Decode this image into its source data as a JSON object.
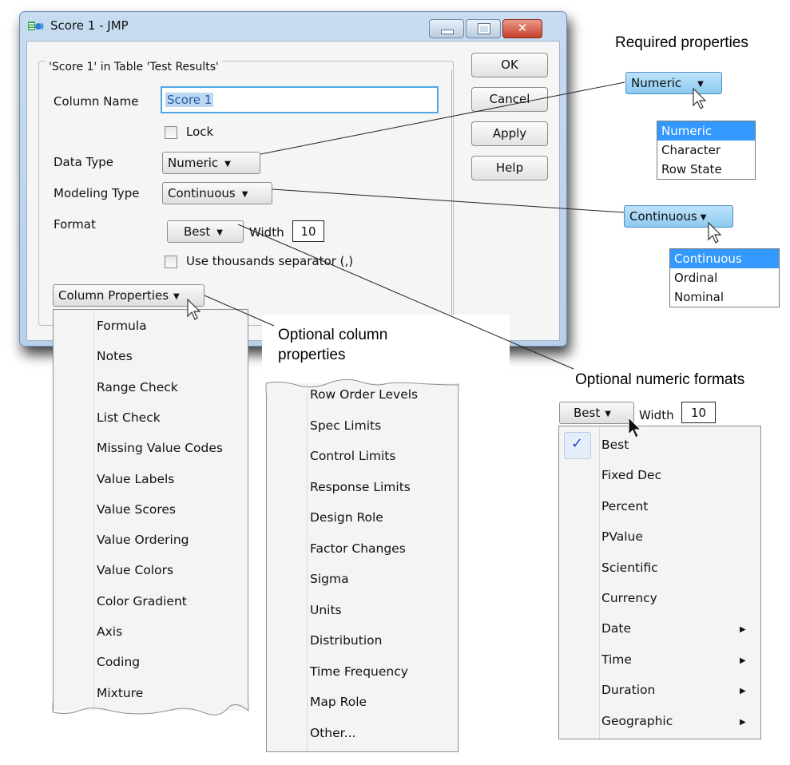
{
  "window": {
    "title": "Score 1 - JMP",
    "icon": "jmp-app-icon",
    "controls": {
      "minimize": "minimize-icon",
      "maximize": "maximize-icon",
      "close": "close-icon"
    }
  },
  "dialog": {
    "group_title": "'Score 1' in Table 'Test Results'",
    "column_name_label": "Column Name",
    "column_name_value": "Score 1",
    "lock_label": "Lock",
    "lock_checked": false,
    "data_type_label": "Data Type",
    "data_type_value": "Numeric",
    "modeling_type_label": "Modeling Type",
    "modeling_type_value": "Continuous",
    "format_label": "Format",
    "format_value": "Best",
    "width_label": "Width",
    "width_value": "10",
    "thousands_label": "Use thousands separator (,)",
    "thousands_checked": false,
    "column_properties_label": "Column Properties",
    "buttons": {
      "ok": "OK",
      "cancel": "Cancel",
      "apply": "Apply",
      "help": "Help"
    }
  },
  "column_properties_menu": {
    "part1": [
      "Formula",
      "Notes",
      "Range Check",
      "List Check",
      "Missing Value Codes",
      "Value Labels",
      "Value Scores",
      "Value Ordering",
      "Value Colors",
      "Color Gradient",
      "Axis",
      "Coding",
      "Mixture"
    ],
    "part2": [
      "Row Order Levels",
      "Spec Limits",
      "Control Limits",
      "Response Limits",
      "Design Role",
      "Factor Changes",
      "Sigma",
      "Units",
      "Distribution",
      "Time Frequency",
      "Map Role",
      "Other..."
    ]
  },
  "callouts": {
    "required": "Required properties",
    "optional_column_line1": "Optional column",
    "optional_column_line2": "properties",
    "optional_formats": "Optional numeric formats"
  },
  "data_type_popup": {
    "value": "Numeric",
    "options": [
      "Numeric",
      "Character",
      "Row State"
    ],
    "selected": "Numeric"
  },
  "modeling_type_popup": {
    "value": "Continuous",
    "options": [
      "Continuous",
      "Ordinal",
      "Nominal"
    ],
    "selected": "Continuous"
  },
  "format_popup": {
    "value": "Best",
    "width_label": "Width",
    "width_value": "10",
    "items": [
      {
        "label": "Best",
        "checked": true,
        "submenu": false
      },
      {
        "label": "Fixed Dec",
        "checked": false,
        "submenu": false
      },
      {
        "label": "Percent",
        "checked": false,
        "submenu": false
      },
      {
        "label": "PValue",
        "checked": false,
        "submenu": false
      },
      {
        "label": "Scientific",
        "checked": false,
        "submenu": false
      },
      {
        "label": "Currency",
        "checked": false,
        "submenu": false
      },
      {
        "label": "Date",
        "checked": false,
        "submenu": true
      },
      {
        "label": "Time",
        "checked": false,
        "submenu": true
      },
      {
        "label": "Duration",
        "checked": false,
        "submenu": true
      },
      {
        "label": "Geographic",
        "checked": false,
        "submenu": true
      }
    ]
  },
  "colors": {
    "selection_blue": "#3399ff",
    "focus_border": "#4ea6e6",
    "close_red": "#c6402b",
    "check_blue": "#1f4fbf"
  }
}
